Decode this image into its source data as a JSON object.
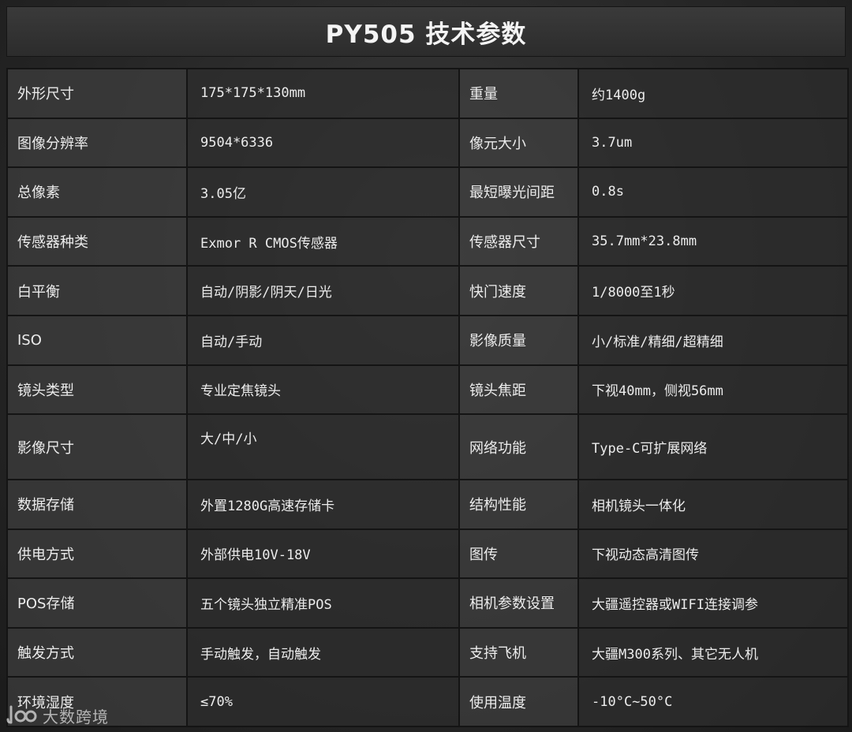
{
  "title": "PY505 技术参数",
  "rows": [
    {
      "label1": "外形尺寸",
      "value1": "175*175*130mm",
      "label2": "重量",
      "value2": "约1400g"
    },
    {
      "label1": "图像分辨率",
      "value1": "9504*6336",
      "label2": "像元大小",
      "value2": "3.7um"
    },
    {
      "label1": "总像素",
      "value1": "3.05亿",
      "label2": "最短曝光间距",
      "value2": "0.8s"
    },
    {
      "label1": "传感器种类",
      "value1": "Exmor R CMOS传感器",
      "label2": "传感器尺寸",
      "value2": "35.7mm*23.8mm"
    },
    {
      "label1": "白平衡",
      "value1": "自动/阴影/阴天/日光",
      "label2": "快门速度",
      "value2": "1/8000至1秒"
    },
    {
      "label1": "ISO",
      "value1": "自动/手动",
      "label2": "影像质量",
      "value2": "小/标准/精细/超精细"
    },
    {
      "label1": "镜头类型",
      "value1": "专业定焦镜头",
      "label2": "镜头焦距",
      "value2": "下视40mm，侧视56mm"
    },
    {
      "label1": "影像尺寸",
      "value1": "大/中/小",
      "label2": "网络功能",
      "value2": "Type-C可扩展网络"
    },
    {
      "label1": "数据存储",
      "value1": "外置1280G高速存储卡",
      "label2": "结构性能",
      "value2": "相机镜头一体化"
    },
    {
      "label1": "供电方式",
      "value1": "外部供电10V-18V",
      "label2": "图传",
      "value2": "下视动态高清图传"
    },
    {
      "label1": "POS存储",
      "value1": "五个镜头独立精准POS",
      "label2": "相机参数设置",
      "value2": "大疆遥控器或WIFI连接调参"
    },
    {
      "label1": "触发方式",
      "value1": "手动触发，自动触发",
      "label2": "支持飞机",
      "value2": "大疆M300系列、其它无人机"
    },
    {
      "label1": "环境湿度",
      "value1": "≤70%",
      "label2": "使用温度",
      "value2": "-10°C~50°C"
    }
  ],
  "watermark": {
    "text": "大数跨境",
    "icon": "brand-logo-icon"
  }
}
